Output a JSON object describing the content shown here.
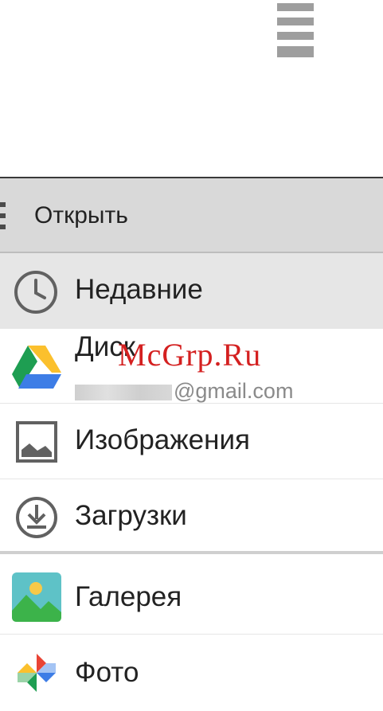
{
  "header": {
    "title": "Открыть"
  },
  "roots": [
    {
      "label": "Недавние",
      "icon": "clock-icon",
      "selected": true
    },
    {
      "label": "Диск",
      "account_suffix": "@gmail.com",
      "icon": "google-drive-icon"
    },
    {
      "label": "Изображения",
      "icon": "image-icon"
    },
    {
      "label": "Загрузки",
      "icon": "download-icon"
    }
  ],
  "apps": [
    {
      "label": "Галерея",
      "icon": "gallery-icon"
    },
    {
      "label": "Фото",
      "icon": "google-photos-icon"
    }
  ],
  "watermark": "McGrp.Ru",
  "colors": {
    "header_bg": "#d9d9d9",
    "selected_bg": "#e6e6e6",
    "watermark": "#d42020"
  }
}
